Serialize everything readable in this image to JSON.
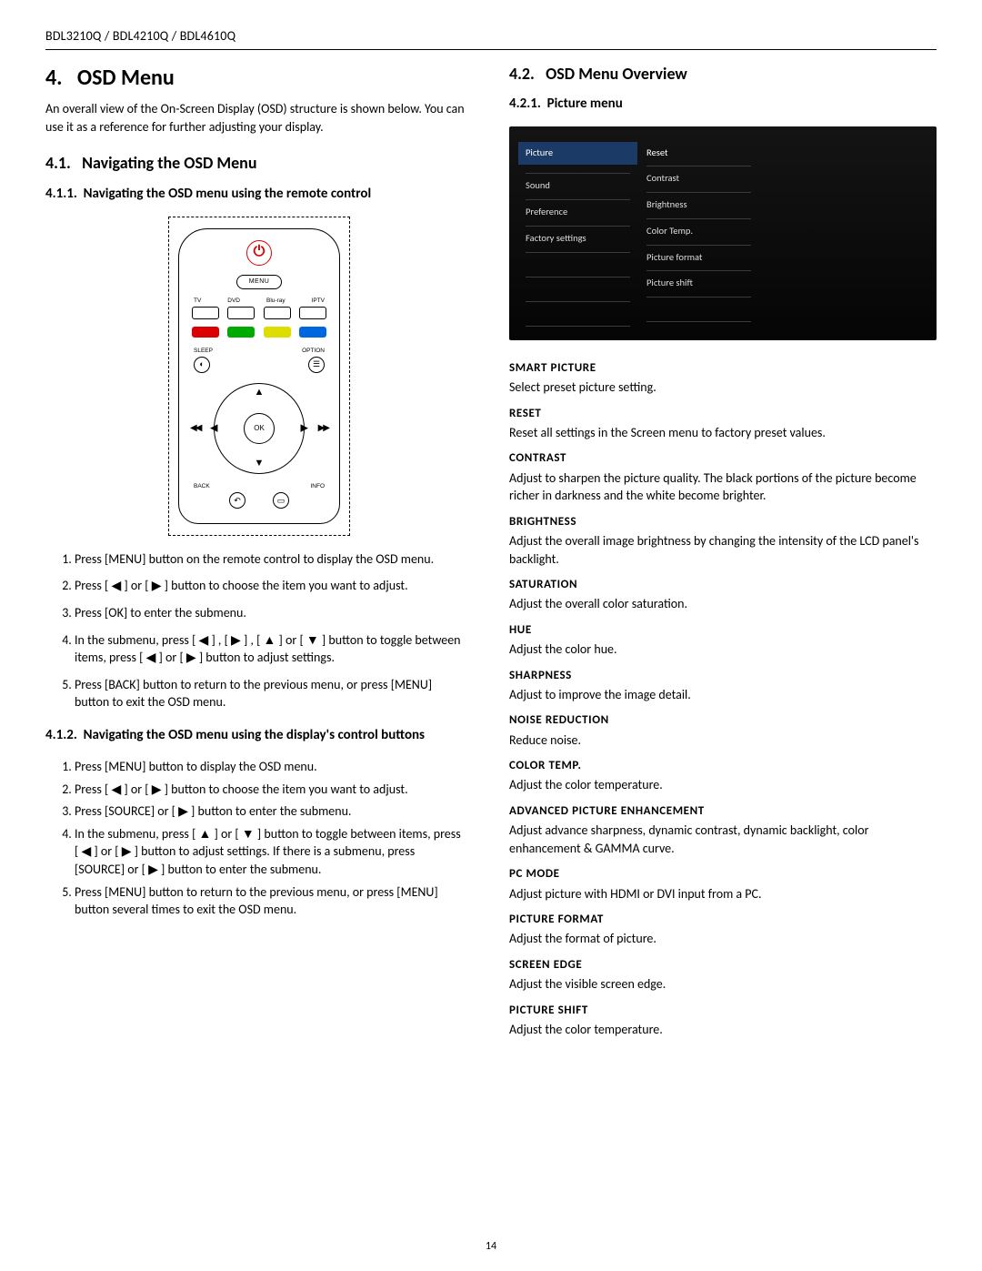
{
  "header": {
    "models": "BDL3210Q / BDL4210Q / BDL4610Q"
  },
  "page_number": "14",
  "left": {
    "h1_num": "4.",
    "h1_title": "OSD Menu",
    "intro": "An overall view of the On-Screen Display (OSD) structure is shown below. You can use it as a reference for further adjusting your display.",
    "h2_41_num": "4.1.",
    "h2_41_title": "Navigating  the OSD Menu",
    "h3_411_num": "4.1.1.",
    "h3_411_title": "Navigating the OSD menu using the remote control",
    "remote": {
      "menu": "MENU",
      "src_labels": [
        "TV",
        "DVD",
        "Blu-ray",
        "IPTV"
      ],
      "sleep": "SLEEP",
      "option": "OPTION",
      "ok": "OK",
      "back": "BACK",
      "info": "INFO"
    },
    "steps_411": [
      "Press [MENU] button on the remote control to display the OSD menu.",
      "Press [ ◀ ] or [ ▶ ] button to choose the item you want to adjust.",
      "Press [OK] to enter the submenu.",
      "In the submenu, press [ ◀ ] , [ ▶ ] , [ ▲ ] or [ ▼ ] button to toggle between items, press [ ◀ ] or [ ▶ ] button to adjust settings.",
      "Press [BACK] button to return to the previous menu, or press [MENU] button to exit the OSD menu."
    ],
    "h3_412_num": "4.1.2.",
    "h3_412_title": "Navigating the OSD menu using the display's control buttons",
    "steps_412": [
      "Press [MENU] button to display the OSD menu.",
      "Press [ ◀ ] or [ ▶ ] button to choose the item you want to adjust.",
      "Press [SOURCE] or [ ▶ ] button to enter the submenu.",
      "In the submenu, press [ ▲ ] or [ ▼ ] button to toggle between items, press [ ◀ ] or [ ▶ ] button to adjust settings. If there is a submenu, press [SOURCE] or [ ▶ ] button to enter the submenu.",
      "Press [MENU] button to return to the previous menu, or press [MENU] button several times to exit the OSD menu."
    ]
  },
  "right": {
    "h2_42_num": "4.2.",
    "h2_42_title": "OSD Menu Overview",
    "h3_421_num": "4.2.1.",
    "h3_421_title": "Picture menu",
    "osd_left": [
      "Picture",
      "Sound",
      "Preference",
      "Factory settings"
    ],
    "osd_right": [
      "Reset",
      "Contrast",
      "Brightness",
      "Color Temp.",
      "Picture format",
      "Picture shift"
    ],
    "defs": [
      {
        "t": "SMART PICTURE",
        "b": "Select preset picture setting."
      },
      {
        "t": "RESET",
        "b": "Reset all settings in the Screen menu to factory preset values."
      },
      {
        "t": "CONTRAST",
        "b": "Adjust to sharpen the picture quality. The black portions of the picture become richer in darkness and the white become brighter."
      },
      {
        "t": "BRIGHTNESS",
        "b": "Adjust the overall image brightness by changing the intensity of the LCD panel's backlight."
      },
      {
        "t": "SATURATION",
        "b": "Adjust the overall color saturation."
      },
      {
        "t": "HUE",
        "b": "Adjust the color hue."
      },
      {
        "t": "SHARPNESS",
        "b": "Adjust to improve the image detail."
      },
      {
        "t": "NOISE REDUCTION",
        "b": "Reduce noise."
      },
      {
        "t": "COLOR TEMP.",
        "b": "Adjust the color temperature."
      },
      {
        "t": "ADVANCED PICTURE ENHANCEMENT",
        "b": "Adjust advance sharpness, dynamic contrast, dynamic backlight, color enhancement & GAMMA curve."
      },
      {
        "t": "PC MODE",
        "b": "Adjust picture with HDMI or DVI input from a PC."
      },
      {
        "t": "PICTURE FORMAT",
        "b": "Adjust the format of picture."
      },
      {
        "t": "SCREEN EDGE",
        "b": "Adjust the visible screen edge."
      },
      {
        "t": "PICTURE SHIFT",
        "b": "Adjust the color temperature."
      }
    ]
  }
}
